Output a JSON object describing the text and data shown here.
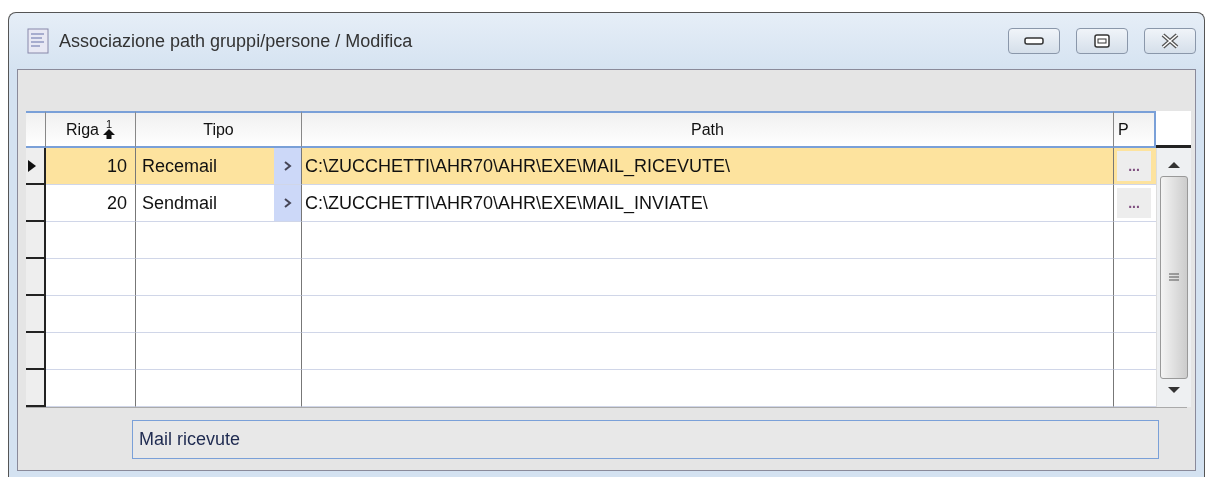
{
  "window": {
    "title": "Associazione path gruppi/persone / Modifica"
  },
  "table": {
    "columns": [
      "Riga",
      "Tipo",
      "Path",
      "P"
    ],
    "sort_mark": "1",
    "rows": [
      {
        "riga": "10",
        "tipo": "Recemail",
        "path": "C:\\ZUCCHETTI\\AHR70\\AHR\\EXE\\MAIL_RICEVUTE\\",
        "button": "...",
        "selected": true
      },
      {
        "riga": "20",
        "tipo": "Sendmail",
        "path": "C:\\ZUCCHETTI\\AHR70\\AHR\\EXE\\MAIL_INVIATE\\",
        "button": "...",
        "selected": false
      }
    ]
  },
  "description": {
    "value": "Mail ricevute"
  }
}
